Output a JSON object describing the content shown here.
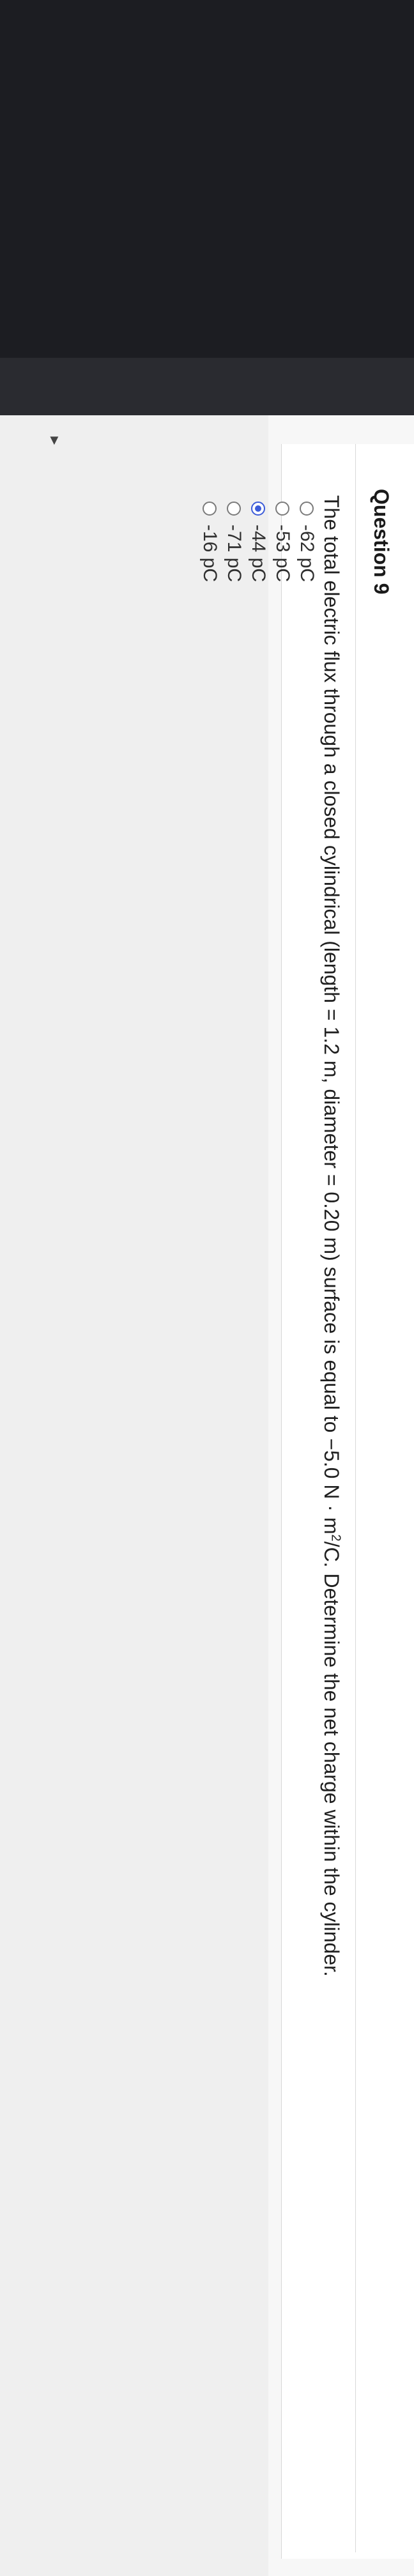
{
  "question": {
    "title": "Question 9",
    "text_pre": "The total electric flux through a closed cylindrical (length = 1.2 m, diameter = 0.20 m) surface is equal to −5.0 N · m",
    "text_sup": "2",
    "text_post": "/C. Determine the net charge within the cylinder.",
    "options": [
      {
        "label": "-62 pC",
        "selected": false
      },
      {
        "label": "-53 pC",
        "selected": false
      },
      {
        "label": "-44 pC",
        "selected": true
      },
      {
        "label": "-71 pC",
        "selected": false
      },
      {
        "label": "-16 pC",
        "selected": false
      }
    ]
  },
  "icons": {
    "collapse": "triangle-down-icon"
  },
  "colors": {
    "accent": "#3b5bd9",
    "bezel": "#1c1d22"
  }
}
